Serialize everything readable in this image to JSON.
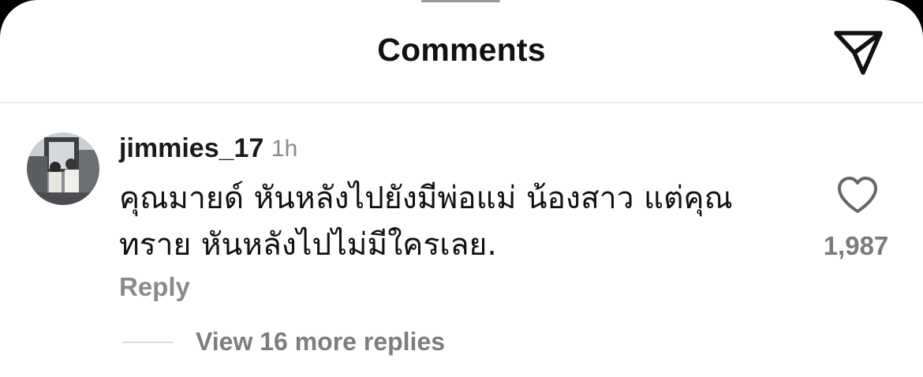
{
  "header": {
    "title": "Comments",
    "share_icon": "paper-plane-icon"
  },
  "comment": {
    "avatar": "user-avatar-photo",
    "username": "jimmies_17",
    "time": "1h",
    "text": "คุณมายด์ หันหลังไปยังมีพ่อแม่ น้องสาว แต่คุณทราย หันหลังไปไม่มีใครเลย.",
    "like_icon": "heart-outline-icon",
    "like_count": "1,987",
    "reply_label": "Reply",
    "view_replies_label": "View 16 more replies"
  }
}
